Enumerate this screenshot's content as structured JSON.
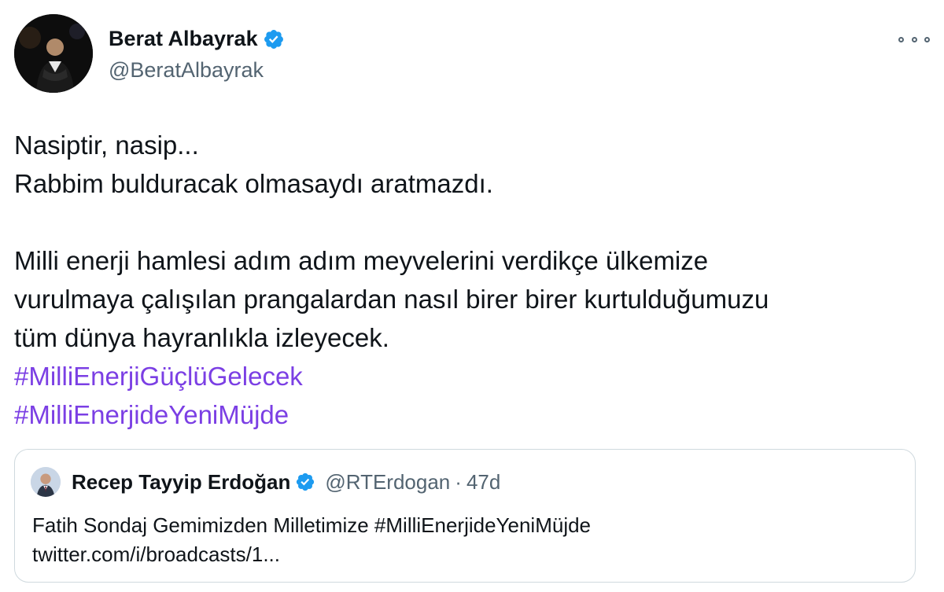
{
  "author": {
    "name": "Berat Albayrak",
    "handle": "@BeratAlbayrak",
    "verified": true
  },
  "tweet": {
    "line1": "Nasiptir, nasip...",
    "line2": "Rabbim bulduracak olmasaydı aratmazdı.",
    "line3": "Milli enerji hamlesi adım adım meyvelerini verdikçe ülkemize",
    "line4": "vurulmaya çalışılan prangalardan nasıl birer birer kurtulduğumuzu",
    "line5": "tüm dünya hayranlıkla izleyecek.",
    "hashtag1": "#MilliEnerjiGüçlüGelecek",
    "hashtag2": "#MilliEnerjideYeniMüjde"
  },
  "quoted": {
    "name": "Recep Tayyip Erdoğan",
    "handle": "@RTErdogan",
    "separator": "·",
    "time": "47d",
    "text_line1": "Fatih Sondaj Gemimizden Milletimize #MilliEnerjideYeniMüjde",
    "text_line2": "twitter.com/i/broadcasts/1..."
  },
  "icons": {
    "verified": "verified-badge-icon",
    "more": "more-options-icon"
  },
  "colors": {
    "hashtag": "#7b3fe4",
    "verified": "#1d9bf0",
    "secondary_text": "#536471",
    "border": "#cfd9de"
  }
}
